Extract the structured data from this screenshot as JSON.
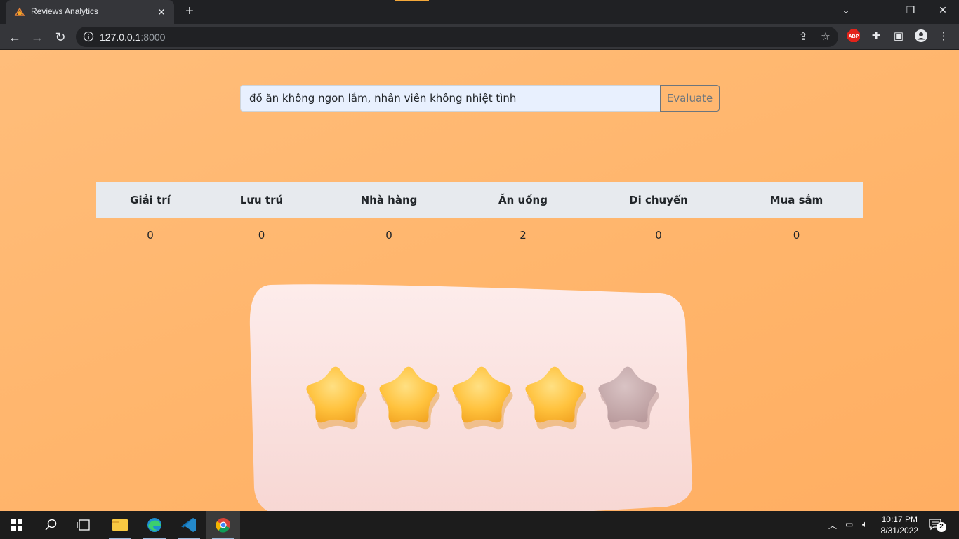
{
  "browser": {
    "tab_title": "Reviews Analytics",
    "url_host": "127.0.0.1",
    "url_port": ":8000"
  },
  "form": {
    "review_text": "đồ ăn không ngon lắm, nhân viên không nhiệt tình",
    "evaluate_label": "Evaluate"
  },
  "table": {
    "headers": [
      "Giải trí",
      "Lưu trú",
      "Nhà hàng",
      "Ăn uống",
      "Di chuyển",
      "Mua sắm"
    ],
    "values": [
      "0",
      "0",
      "0",
      "2",
      "0",
      "0"
    ]
  },
  "illustration": {
    "rating_filled": 4,
    "rating_max": 5
  },
  "taskbar": {
    "time": "10:17 PM",
    "date": "8/31/2022",
    "notifications": "2"
  },
  "colors": {
    "page_background": "#ffb86e",
    "star_filled": "#ffc23d",
    "star_empty": "#c8aeb0",
    "bubble": "#fbe3e0"
  }
}
